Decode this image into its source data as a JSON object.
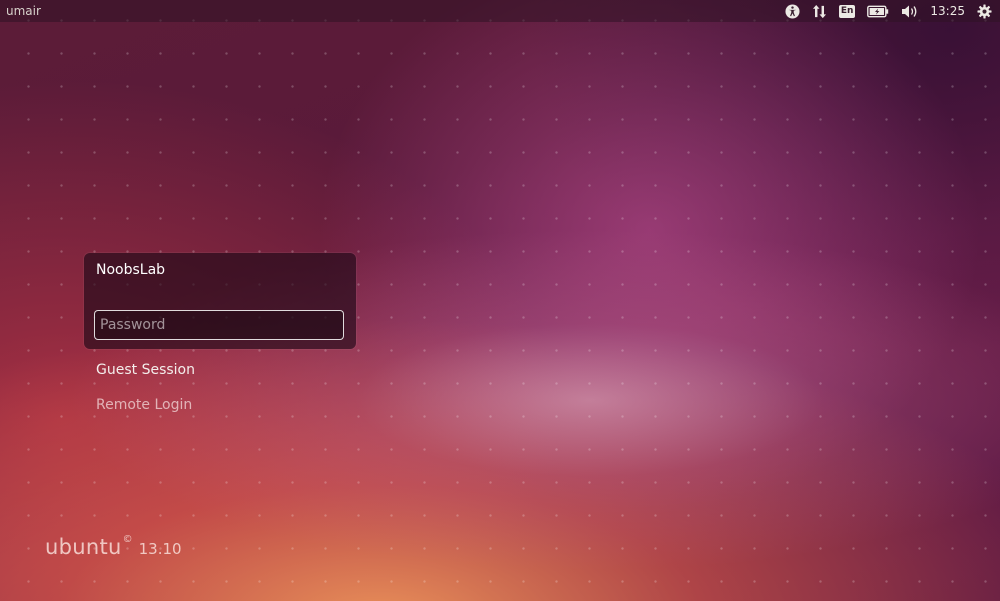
{
  "top_panel": {
    "hostname": "umair",
    "keyboard_layout": "En",
    "clock": "13:25",
    "icons": [
      "accessibility-icon",
      "network-icon",
      "battery-icon",
      "volume-icon",
      "gear-icon"
    ]
  },
  "login": {
    "user_name": "NoobsLab",
    "password_placeholder": "Password",
    "password_value": ""
  },
  "sessions": {
    "guest": "Guest Session",
    "remote": "Remote Login"
  },
  "branding": {
    "word": "ubuntu",
    "mark": "©",
    "version": "13.10"
  },
  "colors": {
    "background": "#5c1c38",
    "panel": "#301224",
    "text": "#ffffff"
  }
}
